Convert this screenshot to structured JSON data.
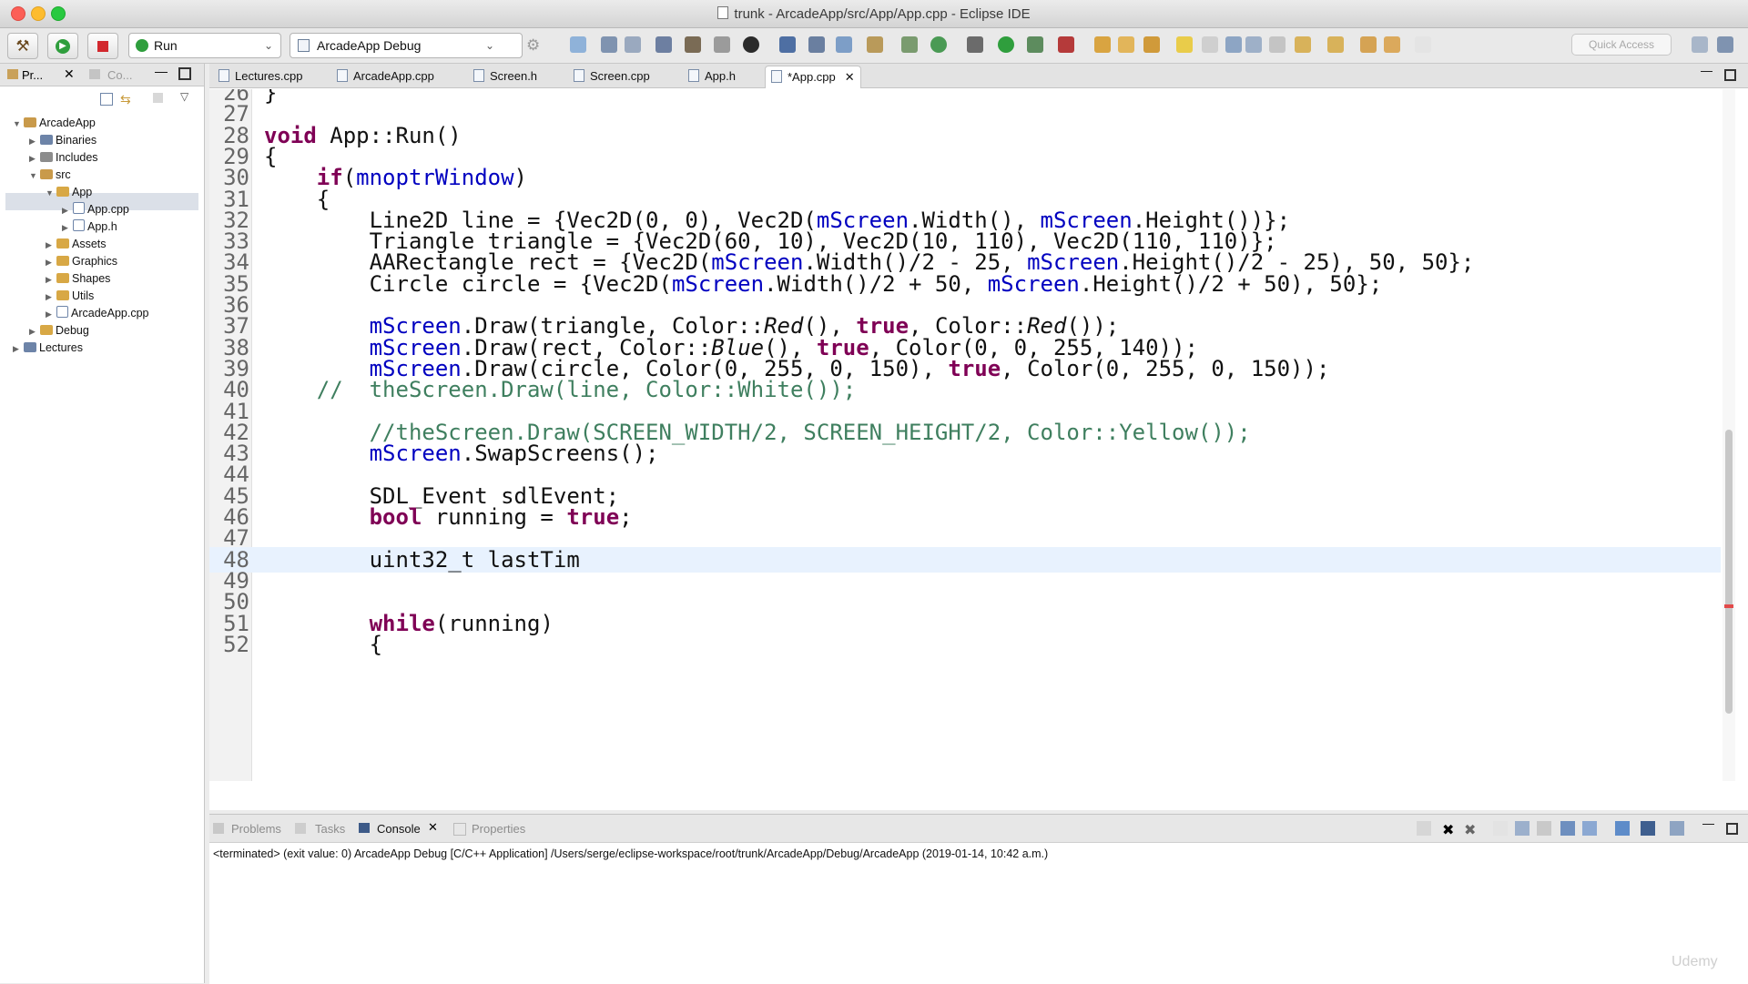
{
  "window": {
    "title": "trunk - ArcadeApp/src/App/App.cpp - Eclipse IDE"
  },
  "colors": {
    "close": "#fc5f57",
    "minimize": "#fdbc2e",
    "maximize": "#28c940",
    "keyword": "#7f0055",
    "field": "#0000c0",
    "comment": "#3f7f5f",
    "current_line": "#e8f2fe"
  },
  "toolbar": {
    "run_config_label": "Run",
    "launch_target_label": "ArcadeApp Debug",
    "quick_access_placeholder": "Quick Access",
    "icons": [
      "hammer-icon",
      "debug-icon",
      "stop-icon",
      "run-icon",
      "gear-icon"
    ]
  },
  "left_panel": {
    "tabs": [
      {
        "label": "Pr..."
      },
      {
        "label": "Co..."
      }
    ],
    "tree": [
      {
        "label": "ArcadeApp"
      },
      {
        "label": "Binaries"
      },
      {
        "label": "Includes"
      },
      {
        "label": "src"
      },
      {
        "label": "App"
      },
      {
        "label": "App.cpp"
      },
      {
        "label": "App.h"
      },
      {
        "label": "Assets"
      },
      {
        "label": "Graphics"
      },
      {
        "label": "Shapes"
      },
      {
        "label": "Utils"
      },
      {
        "label": "ArcadeApp.cpp"
      },
      {
        "label": "Debug"
      },
      {
        "label": "Lectures"
      }
    ],
    "selected": "App.cpp"
  },
  "editor": {
    "tabs": [
      {
        "label": "Lectures.cpp"
      },
      {
        "label": "ArcadeApp.cpp"
      },
      {
        "label": "Screen.h"
      },
      {
        "label": "Screen.cpp"
      },
      {
        "label": "App.h"
      },
      {
        "label": "*App.cpp"
      }
    ],
    "active_tab": "*App.cpp",
    "lines": [
      {
        "n": "26",
        "code": "}"
      },
      {
        "n": "27",
        "code": ""
      },
      {
        "n": "28",
        "code": "void App::Run()"
      },
      {
        "n": "29",
        "code": "{"
      },
      {
        "n": "30",
        "code": "    if(mnoptrWindow)"
      },
      {
        "n": "31",
        "code": "    {"
      },
      {
        "n": "32",
        "code": "        Line2D line = {Vec2D(0, 0), Vec2D(mScreen.Width(), mScreen.Height())};"
      },
      {
        "n": "33",
        "code": "        Triangle triangle = {Vec2D(60, 10), Vec2D(10, 110), Vec2D(110, 110)};"
      },
      {
        "n": "34",
        "code": "        AARectangle rect = {Vec2D(mScreen.Width()/2 - 25, mScreen.Height()/2 - 25), 50, 50};"
      },
      {
        "n": "35",
        "code": "        Circle circle = {Vec2D(mScreen.Width()/2 + 50, mScreen.Height()/2 + 50), 50};"
      },
      {
        "n": "36",
        "code": ""
      },
      {
        "n": "37",
        "code": "        mScreen.Draw(triangle, Color::Red(), true, Color::Red());"
      },
      {
        "n": "38",
        "code": "        mScreen.Draw(rect, Color::Blue(), true, Color(0, 0, 255, 140));"
      },
      {
        "n": "39",
        "code": "        mScreen.Draw(circle, Color(0, 255, 0, 150), true, Color(0, 255, 0, 150));"
      },
      {
        "n": "40",
        "code": "    //  theScreen.Draw(line, Color::White());"
      },
      {
        "n": "41",
        "code": ""
      },
      {
        "n": "42",
        "code": "        //theScreen.Draw(SCREEN_WIDTH/2, SCREEN_HEIGHT/2, Color::Yellow());"
      },
      {
        "n": "43",
        "code": "        mScreen.SwapScreens();"
      },
      {
        "n": "44",
        "code": ""
      },
      {
        "n": "45",
        "code": "        SDL_Event sdlEvent;"
      },
      {
        "n": "46",
        "code": "        bool running = true;"
      },
      {
        "n": "47",
        "code": ""
      },
      {
        "n": "48",
        "code": "        uint32_t lastTim"
      },
      {
        "n": "49",
        "code": ""
      },
      {
        "n": "50",
        "code": ""
      },
      {
        "n": "51",
        "code": "        while(running)"
      },
      {
        "n": "52",
        "code": "        {"
      }
    ],
    "current_line": "48"
  },
  "bottom_panel": {
    "tabs": [
      {
        "label": "Problems"
      },
      {
        "label": "Tasks"
      },
      {
        "label": "Console"
      },
      {
        "label": "Properties"
      }
    ],
    "active_tab": "Console",
    "status_text": "<terminated> (exit value: 0) ArcadeApp Debug [C/C++ Application] /Users/serge/eclipse-workspace/root/trunk/ArcadeApp/Debug/ArcadeApp (2019-01-14, 10:42 a.m.)"
  },
  "watermark": "Udemy"
}
